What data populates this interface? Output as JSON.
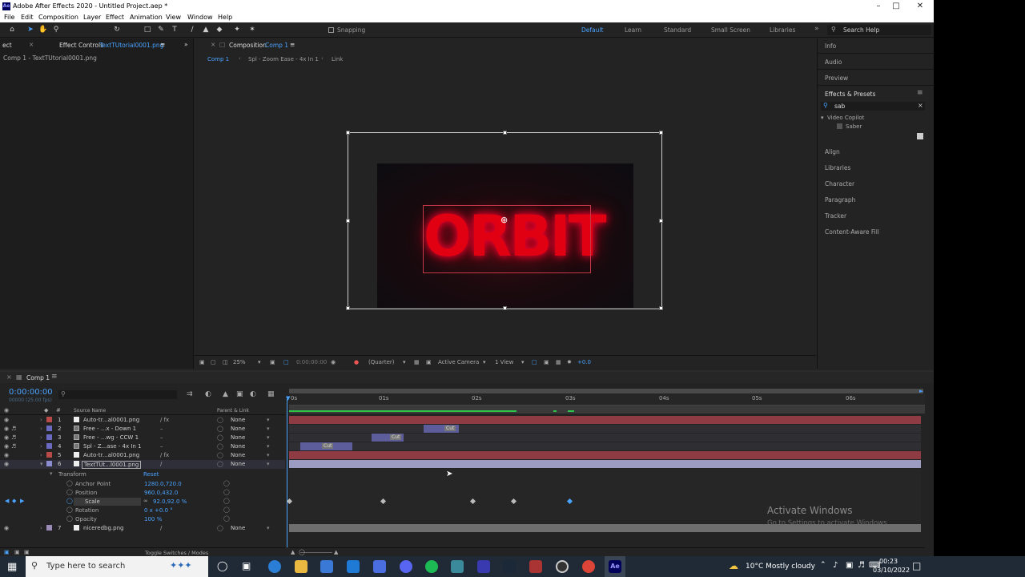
{
  "window": {
    "title": "Adobe After Effects 2020 - Untitled Project.aep *",
    "app_badge": "Ae"
  },
  "menu": [
    "File",
    "Edit",
    "Composition",
    "Layer",
    "Effect",
    "Animation",
    "View",
    "Window",
    "Help"
  ],
  "toolbar": {
    "snapping": "Snapping",
    "workspaces": [
      "Default",
      "Learn",
      "Standard",
      "Small Screen",
      "Libraries"
    ],
    "search_help": "Search Help"
  },
  "left_panel": {
    "tab_prefix": "ect",
    "tab_label": "Effect Controls",
    "tab_file": "TextTUtorial0001.png",
    "breadcrumb": "Comp 1 - TextTUtorial0001.png"
  },
  "comp_panel": {
    "tab_label": "Composition",
    "tab_comp": "Comp 1",
    "flowchart": [
      "Comp 1",
      "Spl - Zoom Ease - 4x In 1",
      "Link"
    ],
    "artwork_text": "ORBIT",
    "viewer_bar": {
      "zoom": "25%",
      "timecode": "0:00:00:00",
      "resolution": "(Quarter)",
      "camera": "Active Camera",
      "views": "1 View",
      "exposure": "+0.0"
    }
  },
  "right_panel": {
    "items_top": [
      "Info",
      "Audio",
      "Preview"
    ],
    "effects_presets": "Effects & Presets",
    "search_value": "sab",
    "tree_folder": "Video Copilot",
    "tree_item": "Saber",
    "items_bottom": [
      "Align",
      "Libraries",
      "Character",
      "Paragraph",
      "Tracker",
      "Content-Aware Fill"
    ]
  },
  "timeline": {
    "tab": "Comp 1",
    "timecode": "0:00:00:00",
    "frame_info": "00000 (25.00 fps)",
    "col_source": "Source Name",
    "col_parent": "Parent & Link",
    "ruler": [
      "0s",
      "01s",
      "02s",
      "03s",
      "04s",
      "05s",
      "06s"
    ],
    "layers": [
      {
        "num": "1",
        "name": "Auto-tr...al0001.png",
        "parent": "None",
        "color": "#b94a4a"
      },
      {
        "num": "2",
        "name": "Free - ...x - Down 1",
        "parent": "None",
        "color": "#6a6ac0"
      },
      {
        "num": "3",
        "name": "Free - ...wg - CCW 1",
        "parent": "None",
        "color": "#6a6ac0"
      },
      {
        "num": "4",
        "name": "Spl - Z...ase - 4x In 1",
        "parent": "None",
        "color": "#6a6ac0"
      },
      {
        "num": "5",
        "name": "Auto-tr...al0001.png",
        "parent": "None",
        "color": "#b94a4a"
      },
      {
        "num": "6",
        "name": "TextTUt...l0001.png",
        "parent": "None",
        "color": "#8c8cd0"
      },
      {
        "num": "7",
        "name": "niceredbg.png",
        "parent": "None",
        "color": "#9b8bb8"
      }
    ],
    "transform": {
      "label": "Transform",
      "reset": "Reset",
      "props": [
        {
          "name": "Anchor Point",
          "value": "1280.0,720.0"
        },
        {
          "name": "Position",
          "value": "960.0,432.0"
        },
        {
          "name": "Scale",
          "value": "92.0,92.0 %"
        },
        {
          "name": "Rotation",
          "value": "0 x +0.0 °"
        },
        {
          "name": "Opacity",
          "value": "100 %"
        }
      ]
    },
    "clip_labels": [
      "Cut",
      "Cut",
      "Cut"
    ],
    "footer": "Toggle Switches / Modes"
  },
  "watermark": {
    "line1": "Activate Windows",
    "line2": "Go to Settings to activate Windows."
  },
  "taskbar": {
    "search_placeholder": "Type here to search",
    "weather": "10°C  Mostly cloudy",
    "time": "00:23",
    "date": "03/10/2022"
  }
}
